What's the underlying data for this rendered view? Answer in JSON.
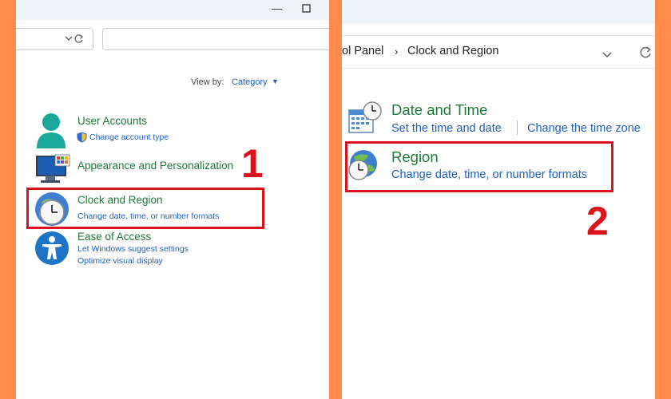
{
  "left_window": {
    "view_by_label": "View by:",
    "view_by_value": "Category",
    "categories": [
      {
        "title": "User Accounts",
        "links": [
          "Change account type"
        ]
      },
      {
        "title": "Appearance and Personalization",
        "links": []
      },
      {
        "title": "Clock and Region",
        "links": [
          "Change date, time, or number formats"
        ]
      },
      {
        "title": "Ease of Access",
        "links": [
          "Let Windows suggest settings",
          "Optimize visual display"
        ]
      }
    ],
    "step_number": "1"
  },
  "right_window": {
    "breadcrumb": [
      "ol Panel",
      "Clock and Region"
    ],
    "items": [
      {
        "title": "Date and Time",
        "links": [
          "Set the time and date",
          "Change the time zone"
        ]
      },
      {
        "title": "Region",
        "links": [
          "Change date, time, or number formats"
        ]
      }
    ],
    "step_number": "2"
  },
  "colors": {
    "background": "#ff8c4a",
    "highlight": "#d9141c",
    "title_green": "#1e7a38",
    "link_blue": "#1f5fbf"
  },
  "icons": [
    "minimize-icon",
    "maximize-icon",
    "chevron-down-icon",
    "refresh-icon",
    "user-accounts-icon",
    "shield-icon",
    "appearance-icon",
    "clock-region-icon",
    "ease-of-access-icon",
    "breadcrumb-separator-icon",
    "date-time-icon",
    "region-icon"
  ]
}
